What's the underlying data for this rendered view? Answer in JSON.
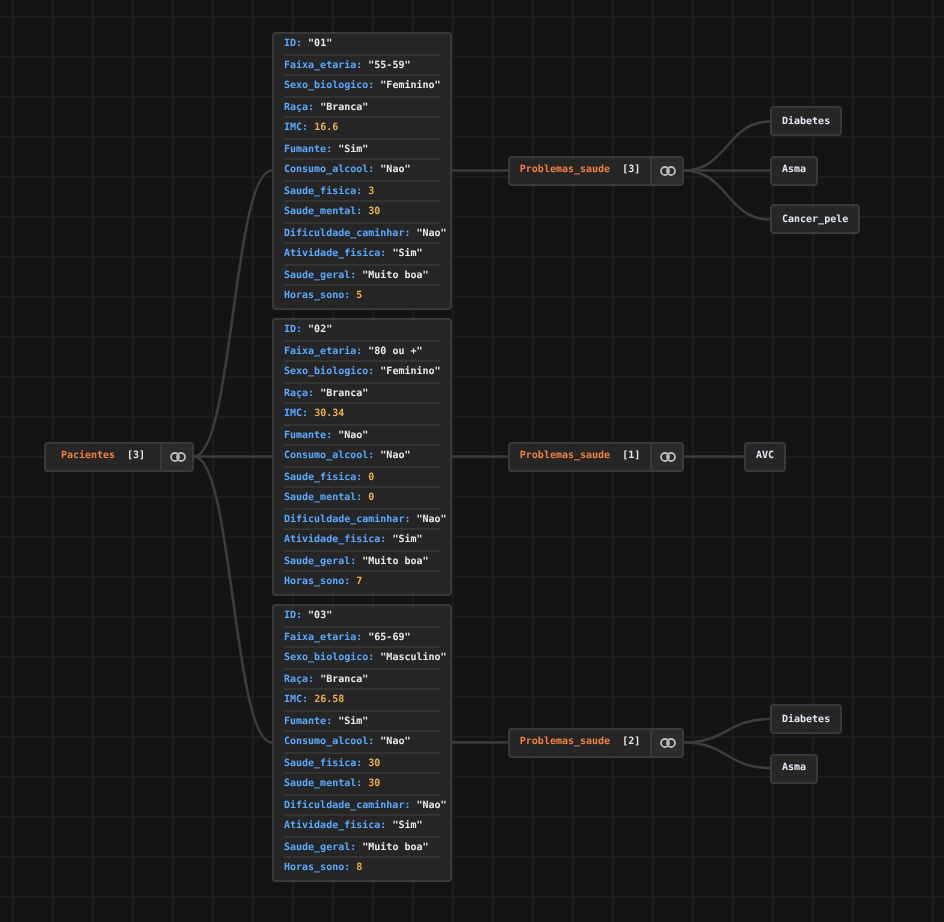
{
  "root": {
    "label": "Pacientes",
    "count": "[3]"
  },
  "patients": [
    {
      "fields": [
        {
          "key": "ID:",
          "value": "\"01\"",
          "kind": "string"
        },
        {
          "key": "Faixa_etaria:",
          "value": "\"55-59\"",
          "kind": "string"
        },
        {
          "key": "Sexo_biologico:",
          "value": "\"Feminino\"",
          "kind": "string"
        },
        {
          "key": "Raça:",
          "value": "\"Branca\"",
          "kind": "string"
        },
        {
          "key": "IMC:",
          "value": "16.6",
          "kind": "number"
        },
        {
          "key": "Fumante:",
          "value": "\"Sim\"",
          "kind": "string"
        },
        {
          "key": "Consumo_alcool:",
          "value": "\"Nao\"",
          "kind": "string"
        },
        {
          "key": "Saude_fisica:",
          "value": "3",
          "kind": "number"
        },
        {
          "key": "Saude_mental:",
          "value": "30",
          "kind": "number"
        },
        {
          "key": "Dificuldade_caminhar:",
          "value": "\"Nao\"",
          "kind": "string"
        },
        {
          "key": "Atividade_fisica:",
          "value": "\"Sim\"",
          "kind": "string"
        },
        {
          "key": "Saude_geral:",
          "value": "\"Muito boa\"",
          "kind": "string"
        },
        {
          "key": "Horas_sono:",
          "value": "5",
          "kind": "number"
        }
      ],
      "problems": {
        "label": "Problemas_saude",
        "count": "[3]",
        "items": [
          "Diabetes",
          "Asma",
          "Cancer_pele"
        ]
      }
    },
    {
      "fields": [
        {
          "key": "ID:",
          "value": "\"02\"",
          "kind": "string"
        },
        {
          "key": "Faixa_etaria:",
          "value": "\"80 ou +\"",
          "kind": "string"
        },
        {
          "key": "Sexo_biologico:",
          "value": "\"Feminino\"",
          "kind": "string"
        },
        {
          "key": "Raça:",
          "value": "\"Branca\"",
          "kind": "string"
        },
        {
          "key": "IMC:",
          "value": "30.34",
          "kind": "number"
        },
        {
          "key": "Fumante:",
          "value": "\"Nao\"",
          "kind": "string"
        },
        {
          "key": "Consumo_alcool:",
          "value": "\"Nao\"",
          "kind": "string"
        },
        {
          "key": "Saude_fisica:",
          "value": "0",
          "kind": "number"
        },
        {
          "key": "Saude_mental:",
          "value": "0",
          "kind": "number"
        },
        {
          "key": "Dificuldade_caminhar:",
          "value": "\"Nao\"",
          "kind": "string"
        },
        {
          "key": "Atividade_fisica:",
          "value": "\"Sim\"",
          "kind": "string"
        },
        {
          "key": "Saude_geral:",
          "value": "\"Muito boa\"",
          "kind": "string"
        },
        {
          "key": "Horas_sono:",
          "value": "7",
          "kind": "number"
        }
      ],
      "problems": {
        "label": "Problemas_saude",
        "count": "[1]",
        "items": [
          "AVC"
        ]
      }
    },
    {
      "fields": [
        {
          "key": "ID:",
          "value": "\"03\"",
          "kind": "string"
        },
        {
          "key": "Faixa_etaria:",
          "value": "\"65-69\"",
          "kind": "string"
        },
        {
          "key": "Sexo_biologico:",
          "value": "\"Masculino\"",
          "kind": "string"
        },
        {
          "key": "Raça:",
          "value": "\"Branca\"",
          "kind": "string"
        },
        {
          "key": "IMC:",
          "value": "26.58",
          "kind": "number"
        },
        {
          "key": "Fumante:",
          "value": "\"Sim\"",
          "kind": "string"
        },
        {
          "key": "Consumo_alcool:",
          "value": "\"Nao\"",
          "kind": "string"
        },
        {
          "key": "Saude_fisica:",
          "value": "30",
          "kind": "number"
        },
        {
          "key": "Saude_mental:",
          "value": "30",
          "kind": "number"
        },
        {
          "key": "Dificuldade_caminhar:",
          "value": "\"Nao\"",
          "kind": "string"
        },
        {
          "key": "Atividade_fisica:",
          "value": "\"Sim\"",
          "kind": "string"
        },
        {
          "key": "Saude_geral:",
          "value": "\"Muito boa\"",
          "kind": "string"
        },
        {
          "key": "Horas_sono:",
          "value": "8",
          "kind": "number"
        }
      ],
      "problems": {
        "label": "Problemas_saude",
        "count": "[2]",
        "items": [
          "Diabetes",
          "Asma"
        ]
      }
    }
  ]
}
